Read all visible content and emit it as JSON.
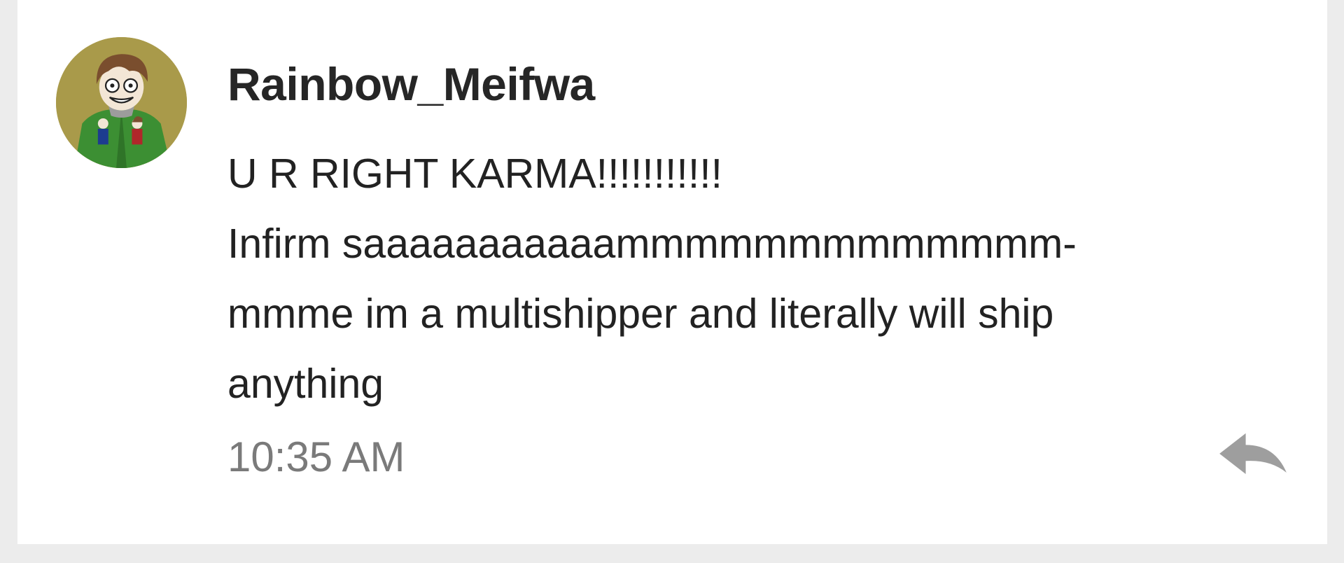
{
  "comment": {
    "username": "Rainbow_Meifwa",
    "message_lines": [
      "U R RIGHT KARMA!!!!!!!!!!!",
      "Infirm saaaaaaaaaaammmmmmmmmmmmm-",
      "mmme im a multishipper and literally will ship",
      "anything"
    ],
    "time": "10:35 AM",
    "avatar_icon": "user-avatar",
    "reply_icon": "reply-arrow-icon"
  },
  "colors": {
    "background": "#ececec",
    "card": "#ffffff",
    "username": "#262626",
    "message": "#222222",
    "timestamp": "#7a7a7a",
    "reply_icon": "#9e9e9e"
  }
}
